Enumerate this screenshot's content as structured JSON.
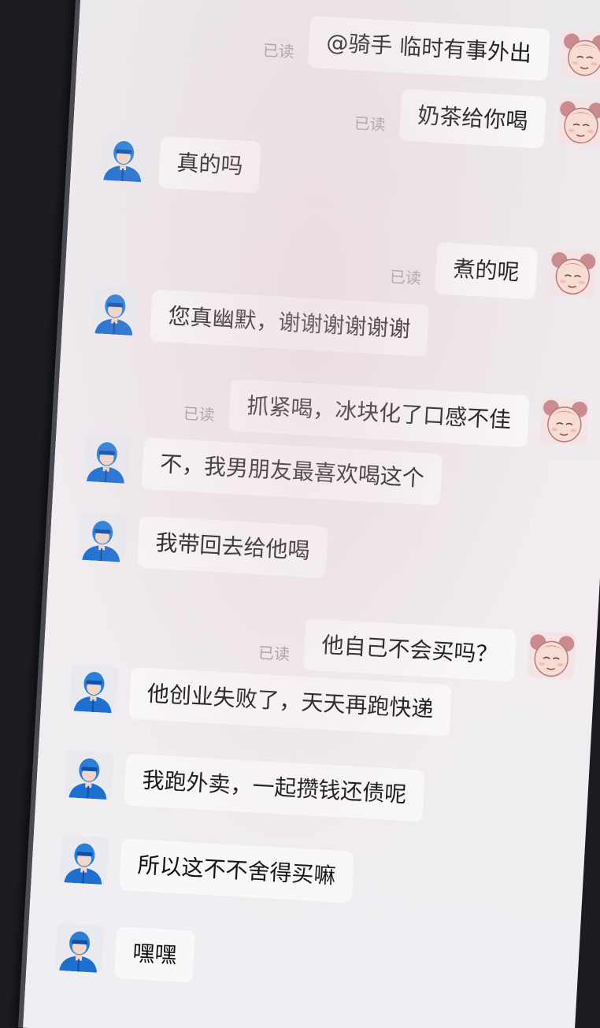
{
  "chat": {
    "read_label": "已读",
    "messages": [
      {
        "side": "right",
        "text": "@骑手 临时有事外出"
      },
      {
        "side": "right",
        "text": "奶茶给你喝"
      },
      {
        "side": "left",
        "text": "真的吗"
      },
      {
        "side": "right",
        "text": "煮的呢"
      },
      {
        "side": "left",
        "text": "您真幽默，谢谢谢谢谢谢"
      },
      {
        "side": "right",
        "text": "抓紧喝，冰块化了口感不佳"
      },
      {
        "side": "left",
        "text": "不，我男朋友最喜欢喝这个"
      },
      {
        "side": "left",
        "text": "我带回去给他喝"
      },
      {
        "side": "right",
        "text": "他自己不会买吗？"
      },
      {
        "side": "left",
        "text": "他创业失败了，天天再跑快递"
      },
      {
        "side": "left",
        "text": "我跑外卖，一起攒钱还债呢"
      },
      {
        "side": "left",
        "text": "所以这不不舍得买嘛"
      },
      {
        "side": "left",
        "text": "嘿嘿"
      }
    ]
  },
  "avatars": {
    "customer_icon": "cartoon-girl-avatar-icon",
    "rider_icon": "blue-rider-avatar-icon",
    "customer_colors": {
      "hair": "#c98b8d",
      "skin": "#f7dcd2"
    },
    "rider_colors": {
      "suit": "#1d6fd0",
      "helmet": "#2a7fd8",
      "skin": "#f1d6c9"
    }
  }
}
